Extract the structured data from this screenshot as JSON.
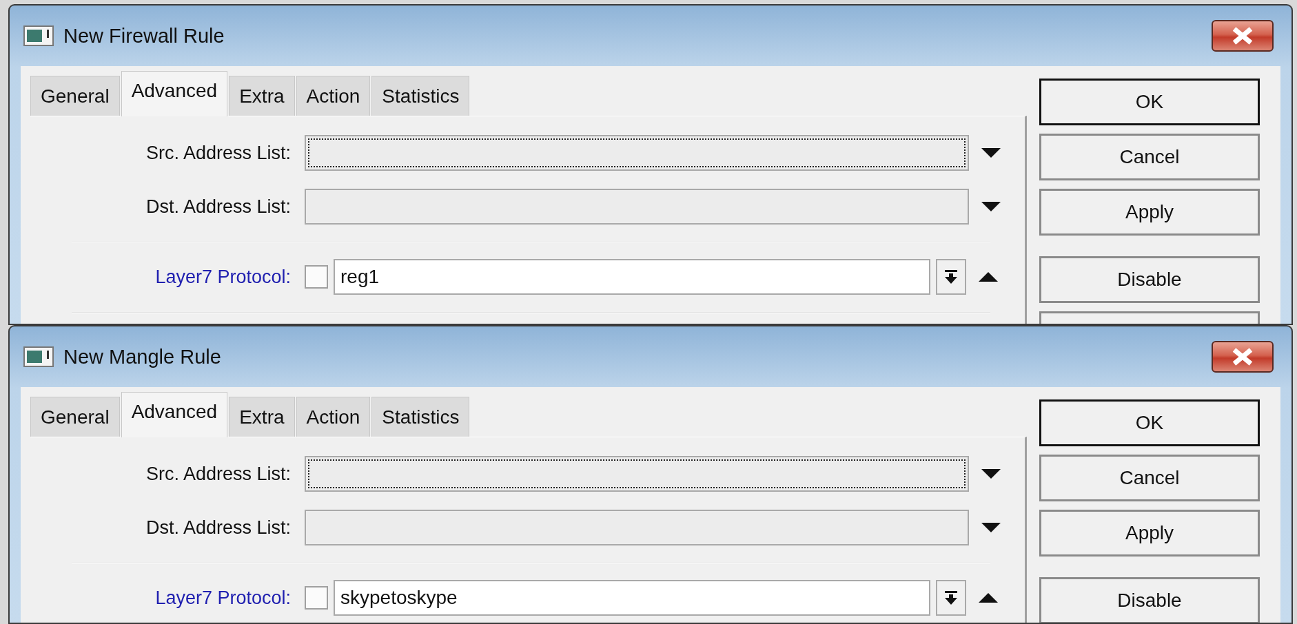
{
  "windows": [
    {
      "title": "New Firewall Rule",
      "tabs": [
        {
          "label": "General",
          "selected": false
        },
        {
          "label": "Advanced",
          "selected": true
        },
        {
          "label": "Extra",
          "selected": false
        },
        {
          "label": "Action",
          "selected": false
        },
        {
          "label": "Statistics",
          "selected": false
        }
      ],
      "address_lists": [
        {
          "label": "Src. Address List:",
          "focused": true
        },
        {
          "label": "Dst. Address List:",
          "focused": false
        }
      ],
      "layer7": {
        "label": "Layer7 Protocol:",
        "checked": false,
        "value": "reg1"
      },
      "button_groups": [
        [
          {
            "kind": "button",
            "label": "OK",
            "default": true
          },
          {
            "kind": "button",
            "label": "Cancel",
            "default": false
          },
          {
            "kind": "button",
            "label": "Apply",
            "default": false
          }
        ],
        [
          {
            "kind": "button",
            "label": "Disable",
            "default": false
          },
          {
            "kind": "cut-off",
            "default": false
          }
        ]
      ]
    },
    {
      "title": "New Mangle Rule",
      "tabs": [
        {
          "label": "General",
          "selected": false
        },
        {
          "label": "Advanced",
          "selected": true
        },
        {
          "label": "Extra",
          "selected": false
        },
        {
          "label": "Action",
          "selected": false
        },
        {
          "label": "Statistics",
          "selected": false
        }
      ],
      "address_lists": [
        {
          "label": "Src. Address List:",
          "focused": true
        },
        {
          "label": "Dst. Address List:",
          "focused": false
        }
      ],
      "layer7": {
        "label": "Layer7 Protocol:",
        "checked": false,
        "value": "skypetoskype"
      },
      "button_groups": [
        [
          {
            "kind": "button",
            "label": "OK",
            "default": true
          },
          {
            "kind": "button",
            "label": "Cancel",
            "default": false
          },
          {
            "kind": "button",
            "label": "Apply",
            "default": false
          }
        ],
        [
          {
            "kind": "button",
            "label": "Disable",
            "default": false
          }
        ]
      ]
    }
  ]
}
